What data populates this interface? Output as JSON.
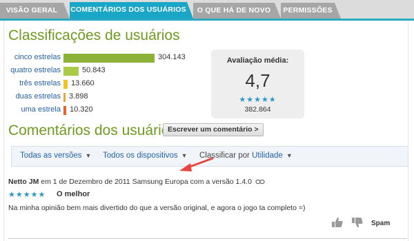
{
  "tabs": [
    {
      "label": "VISÃO GERAL",
      "active": false
    },
    {
      "label": "COMENTÁRIOS DOS USUÁRIOS",
      "active": true
    },
    {
      "label": "O QUE HÁ DE NOVO",
      "active": false
    },
    {
      "label": "PERMISSÕES",
      "active": false
    }
  ],
  "ratings": {
    "heading": "Classificações de usuários",
    "rows": [
      {
        "label": "cinco estrelas",
        "count": "304.143",
        "value": 304143,
        "color": "#8db23a"
      },
      {
        "label": "quatro estrelas",
        "count": "50.843",
        "value": 50843,
        "color": "#aacb48"
      },
      {
        "label": "três estrelas",
        "count": "13.660",
        "value": 13660,
        "color": "#f3c22a"
      },
      {
        "label": "duas estrelas",
        "count": "3.898",
        "value": 3898,
        "color": "#f0a234"
      },
      {
        "label": "uma estrela",
        "count": "10.320",
        "value": 10320,
        "color": "#e8632a"
      }
    ],
    "average": {
      "title": "Avaliação média:",
      "value": "4,7",
      "stars": 4.7,
      "total": "382.864"
    }
  },
  "comments": {
    "heading": "Comentários dos usuários",
    "write_button": "Escrever um comentário >",
    "filters": {
      "versions": "Todas as versões",
      "devices": "Todos os dispositivos",
      "sort_label": "Classificar por",
      "sort_value": "Utilidade"
    },
    "review": {
      "author": "Netto JM",
      "meta": "em 1 de Dezembro de 2011 Samsung Europa com a versão 1.4.0",
      "stars": 5,
      "title": "O melhor",
      "body": "Na minha opinião bem mais divertido do que a versão original, e agora o jogo ta completo =)",
      "spam": "Spam"
    }
  },
  "colors": {
    "accent": "#1aa6c7",
    "heading": "#6e9a1f",
    "link": "#2561a8",
    "stars": "#2a96c8",
    "arrow": "#e8473f"
  }
}
